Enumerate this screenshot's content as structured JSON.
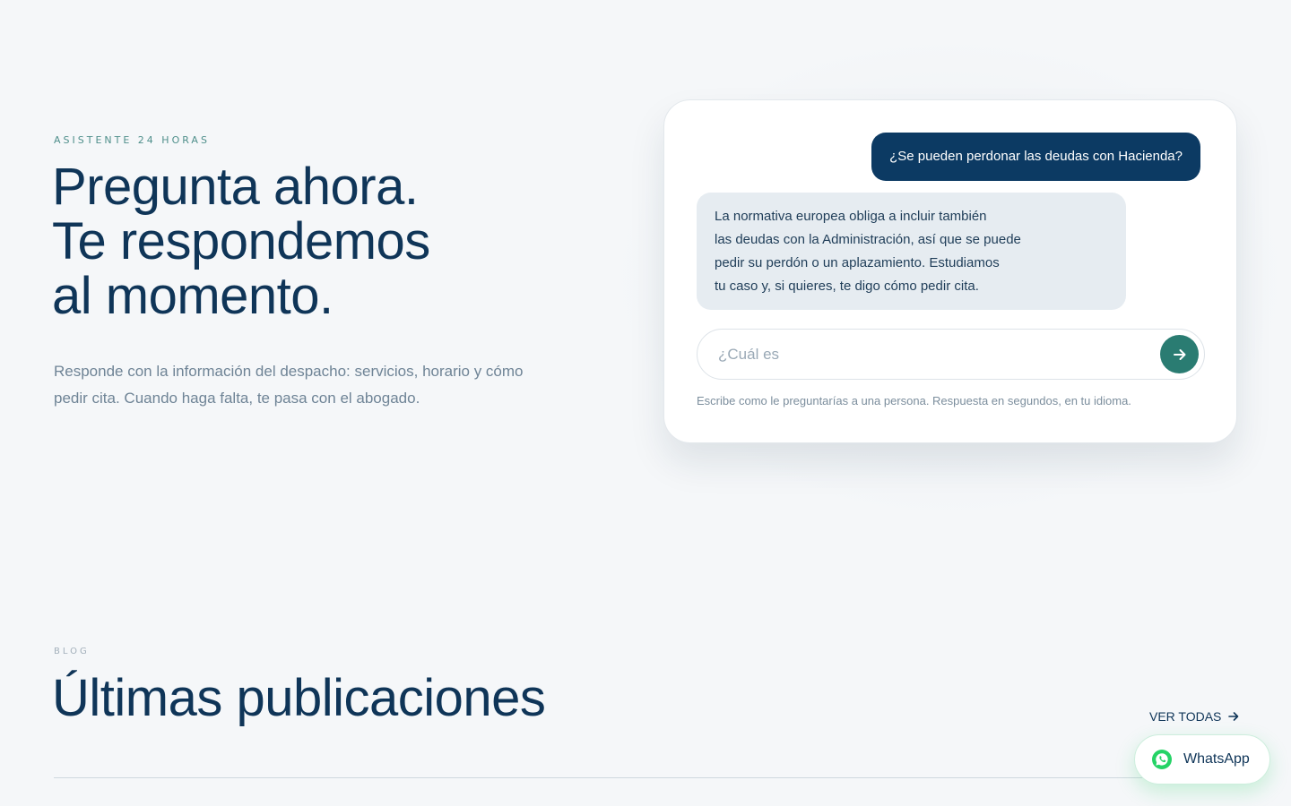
{
  "assistant": {
    "eyebrow": "ASISTENTE 24 HORAS",
    "title_lines": [
      "Pregunta ahora.",
      "Te respondemos",
      "al momento."
    ],
    "description_lines": [
      "Responde con la información del despacho: servicios, horario y cómo",
      "pedir cita. Cuando haga falta, te pasa con el abogado."
    ]
  },
  "chat": {
    "user_message": "¿Se pueden perdonar las deudas con Hacienda?",
    "bot_message_lines": [
      "La normativa europea obliga a incluir también",
      "las deudas con la Administración, así que se puede",
      "pedir su perdón o un aplazamiento. Estudiamos",
      "tu caso y, si quieres, te digo cómo pedir cita."
    ],
    "input_value": "",
    "input_placeholder": "¿Cuál es",
    "send_icon": "arrow-right-icon",
    "hint": "Escribe como le preguntarías a una persona. Respuesta en segundos, en tu idioma."
  },
  "blog": {
    "eyebrow": "BLOG",
    "title": "Últimas publicaciones",
    "see_all": "VER TODAS",
    "see_all_icon": "arrow-right-icon"
  },
  "whatsapp": {
    "label": "WhatsApp",
    "icon": "whatsapp-icon"
  },
  "colors": {
    "background": "#f5f7f9",
    "primary_navy": "#0c3a63",
    "accent_teal": "#2a7c72",
    "bot_bubble": "#e6ecf1",
    "whatsapp_green": "#25d366"
  }
}
